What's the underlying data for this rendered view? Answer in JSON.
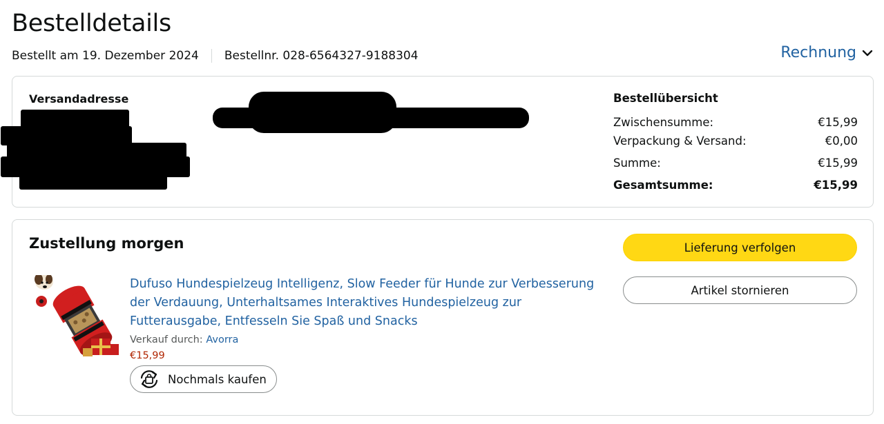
{
  "header": {
    "title": "Bestelldetails",
    "order_date": "Bestellt am 19. Dezember 2024",
    "order_number": "Bestellnr. 028-6564327-9188304",
    "invoice_label": "Rechnung"
  },
  "address": {
    "title": "Versandadresse"
  },
  "summary": {
    "title": "Bestellübersicht",
    "rows": [
      {
        "label": "Zwischensumme:",
        "value": "€15,99"
      },
      {
        "label": "Verpackung & Versand:",
        "value": "€0,00"
      },
      {
        "label": "Summe:",
        "value": "€15,99"
      },
      {
        "label": "Gesamtsumme:",
        "value": "€15,99"
      }
    ]
  },
  "delivery": {
    "status": "Zustellung morgen",
    "track_label": "Lieferung verfolgen",
    "cancel_label": "Artikel stornieren",
    "item": {
      "title": "Dufuso Hundespielzeug Intelligenz, Slow Feeder für Hunde zur Verbesserung der Verdauung, Unterhaltsames Interaktives Hundespielzeug zur Futterausgabe, Entfesseln Sie Spaß und Snacks",
      "seller_prefix": "Verkauf durch:",
      "seller_name": "Avorra",
      "price": "€15,99",
      "rebuy_label": "Nochmals kaufen"
    }
  },
  "colors": {
    "link": "#2162a1",
    "price": "#b12704",
    "primary_button": "#ffd814",
    "border": "#d5d9d9"
  },
  "icons": [
    "chevron-down-icon",
    "buy-again-icon"
  ]
}
